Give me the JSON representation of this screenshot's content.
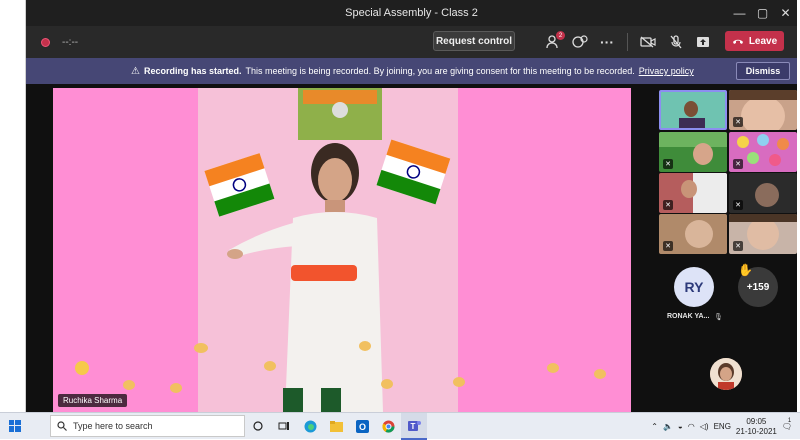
{
  "window": {
    "title": "Special Assembly - Class 2",
    "min": "—",
    "max": "▢",
    "close": "✕"
  },
  "toolbar": {
    "timer": "--:--",
    "request_control": "Request control",
    "participants_badge": "2",
    "leave": "Leave"
  },
  "banner": {
    "headline": "Recording has started.",
    "message": "This meeting is being recorded. By joining, you are giving consent for this meeting to be recorded.",
    "link": "Privacy policy",
    "dismiss": "Dismiss"
  },
  "stage": {
    "speaker_name": "Ruchika Sharma"
  },
  "gallery": {
    "avatar_initials": "RY",
    "avatar_name": "RONAK YA...",
    "overflow_count": "+159"
  },
  "taskbar": {
    "search_placeholder": "Type here to search",
    "language": "ENG",
    "time": "09:05",
    "date": "21-10-2021",
    "notification_count": "1"
  },
  "colors": {
    "leave": "#c4314b",
    "banner": "#464775",
    "stage_bg": "#ff8ed4"
  }
}
